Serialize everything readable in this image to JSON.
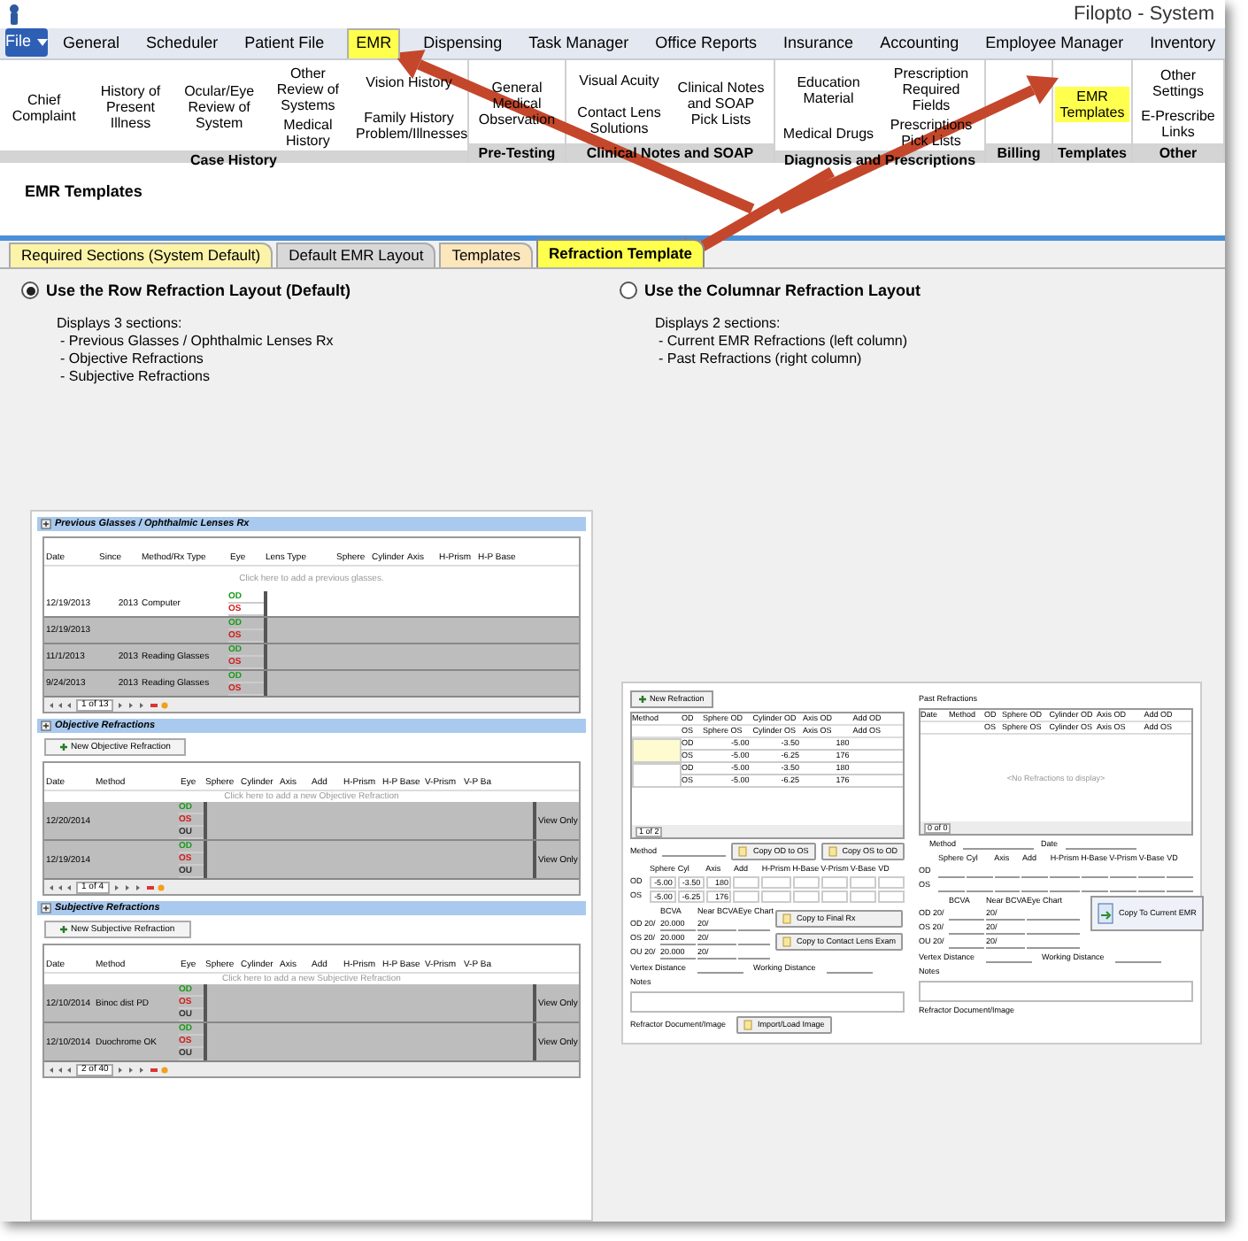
{
  "window": {
    "title": "Filopto - System"
  },
  "menu_tabs": [
    {
      "label": "File",
      "kind": "file",
      "selected": false
    },
    {
      "label": "General",
      "kind": "tab",
      "selected": false
    },
    {
      "label": "Scheduler",
      "kind": "tab",
      "selected": false
    },
    {
      "label": "Patient File",
      "kind": "tab",
      "selected": false
    },
    {
      "label": "EMR",
      "kind": "tab",
      "selected": true
    },
    {
      "label": "Dispensing",
      "kind": "tab",
      "selected": false
    },
    {
      "label": "Task Manager",
      "kind": "tab",
      "selected": false
    },
    {
      "label": "Office Reports",
      "kind": "tab",
      "selected": false
    },
    {
      "label": "Insurance",
      "kind": "tab",
      "selected": false
    },
    {
      "label": "Accounting",
      "kind": "tab",
      "selected": false
    },
    {
      "label": "Employee Manager",
      "kind": "tab",
      "selected": false
    },
    {
      "label": "Inventory",
      "kind": "tab",
      "selected": false
    }
  ],
  "ribbon_groups": [
    {
      "label": "Case History",
      "columns": [
        [
          {
            "label": "Chief Complaint",
            "selected": false
          }
        ],
        [
          {
            "label": "History of Present Illness",
            "selected": false
          }
        ],
        [
          {
            "label": "Ocular/Eye Review of System",
            "selected": false
          }
        ],
        [
          {
            "label": "Other Review of Systems",
            "selected": false
          },
          {
            "label": "Medical History",
            "selected": false
          }
        ],
        [
          {
            "label": "Vision History",
            "selected": false
          },
          {
            "label": "Family History Problem/Illnesses",
            "selected": false
          }
        ]
      ]
    },
    {
      "label": "Pre-Testing",
      "columns": [
        [
          {
            "label": "General Medical Observation",
            "selected": false
          }
        ]
      ]
    },
    {
      "label": "Clinical Notes and SOAP",
      "columns": [
        [
          {
            "label": "Visual Acuity",
            "selected": false
          },
          {
            "label": "Contact Lens Solutions",
            "selected": false
          }
        ],
        [
          {
            "label": "Clinical Notes and SOAP Pick Lists",
            "selected": false
          }
        ]
      ]
    },
    {
      "label": "Diagnosis and Prescriptions",
      "columns": [
        [
          {
            "label": "Education Material",
            "selected": false
          },
          {
            "label": "Medical Drugs",
            "selected": false
          }
        ],
        [
          {
            "label": "Prescription Required Fields",
            "selected": false
          },
          {
            "label": "Prescriptions Pick Lists",
            "selected": false
          }
        ]
      ]
    },
    {
      "label": "Billing"
    },
    {
      "label": "Templates",
      "columns": [
        [
          {
            "label": "EMR Templates",
            "selected": true
          }
        ]
      ]
    },
    {
      "label": "Other",
      "columns": [
        [
          {
            "label": "Other Settings",
            "selected": false
          },
          {
            "label": "E-Prescribe Links",
            "selected": false
          }
        ]
      ]
    }
  ],
  "page": {
    "title": "EMR Templates"
  },
  "tabs": [
    {
      "label": "Required Sections (System Default)",
      "color": "#fbf3a8",
      "selected": false
    },
    {
      "label": "Default EMR Layout",
      "color": "#d8d8d8",
      "selected": false
    },
    {
      "label": "Templates",
      "color": "#fce6bc",
      "selected": false
    },
    {
      "label": "Refraction Template",
      "color": "#ffff4d",
      "selected": true
    }
  ],
  "options": [
    {
      "label": "Use the Row Refraction Layout (Default)",
      "selected": true,
      "description": "Displays 3 sections:",
      "lines": [
        "- Previous Glasses / Ophthalmic Lenses Rx",
        "- Objective Refractions",
        "- Subjective Refractions"
      ]
    },
    {
      "label": "Use the Columnar Refraction Layout",
      "selected": false,
      "description": "Displays 2 sections:",
      "lines": [
        "- Current EMR Refractions (left column)",
        "- Past Refractions (right column)"
      ]
    }
  ],
  "row_preview": {
    "sections": [
      {
        "title": "Previous Glasses / Ophthalmic Lenses Rx",
        "headers": [
          "Date",
          "Since",
          "Method/Rx Type",
          "Eye",
          "Lens Type",
          "Sphere",
          "Cylinder",
          "Axis",
          "H-Prism",
          "H-P Base"
        ],
        "hint": "Click here to add a previous glasses.",
        "rows": [
          {
            "date": "12/19/2013",
            "since": "2013",
            "method": "Computer",
            "eyes": [
              "OD",
              "OS"
            ]
          },
          {
            "date": "12/19/2013",
            "eyes": [
              "OD",
              "OS"
            ]
          },
          {
            "date": "11/1/2013",
            "since": "2013",
            "method": "Reading Glasses",
            "eyes": [
              "OD",
              "OS"
            ]
          },
          {
            "date": "9/24/2013",
            "since": "2013",
            "method": "Reading Glasses",
            "eyes": [
              "OD",
              "OS"
            ]
          }
        ],
        "pager": "1 of 13"
      },
      {
        "title": "Objective Refractions",
        "button": "New Objective Refraction",
        "headers": [
          "Date",
          "Method",
          "Eye",
          "Sphere",
          "Cylinder",
          "Axis",
          "Add",
          "H-Prism",
          "H-P Base",
          "V-Prism",
          "V-P Ba"
        ],
        "hint": "Click here to add a new Objective Refraction",
        "rows": [
          {
            "date": "12/20/2014",
            "eyes": [
              "OD",
              "OS",
              "OU"
            ],
            "status": "View Only"
          },
          {
            "date": "12/19/2014",
            "eyes": [
              "OD",
              "OS",
              "OU"
            ],
            "status": "View Only"
          }
        ],
        "pager": "1 of 4"
      },
      {
        "title": "Subjective Refractions",
        "button": "New Subjective Refraction",
        "headers": [
          "Date",
          "Method",
          "Eye",
          "Sphere",
          "Cylinder",
          "Axis",
          "Add",
          "H-Prism",
          "H-P Base",
          "V-Prism",
          "V-P Ba"
        ],
        "hint": "Click here to add a new Subjective Refraction",
        "rows": [
          {
            "date": "12/10/2014",
            "method": "Binoc dist PD",
            "eyes": [
              "OD",
              "OS",
              "OU"
            ],
            "status": "View Only"
          },
          {
            "date": "12/10/2014",
            "method": "Duochrome OK",
            "eyes": [
              "OD",
              "OS",
              "OU"
            ],
            "status": "View Only"
          }
        ],
        "pager": "2 of 40"
      }
    ]
  },
  "columnar_preview": {
    "current": {
      "button": "New Refraction",
      "headers": [
        [
          "Method",
          "OD",
          "Sphere OD",
          "Cylinder OD",
          "Axis OD",
          "Add OD"
        ],
        [
          "OS",
          "Sphere OS",
          "Cylinder OS",
          "Axis OS",
          "Add OS"
        ]
      ],
      "entries": [
        {
          "selected": true,
          "rows": [
            [
              "OD",
              "-5.00",
              "-3.50",
              "180"
            ],
            [
              "OS",
              "-5.00",
              "-6.25",
              "176"
            ]
          ]
        },
        {
          "selected": false,
          "rows": [
            [
              "OD",
              "-5.00",
              "-3.50",
              "180"
            ],
            [
              "OS",
              "-5.00",
              "-6.25",
              "176"
            ]
          ]
        }
      ],
      "pager": "1 of 2",
      "method_label": "Method",
      "copy_buttons": [
        "Copy OD to OS",
        "Copy OS to OD"
      ],
      "rx_headers": [
        "Sphere",
        "Cyl",
        "Axis",
        "Add",
        "H-Prism",
        "H-Base",
        "V-Prism",
        "V-Base",
        "VD"
      ],
      "rx_rows": [
        {
          "eye": "OD",
          "values": [
            "-5.00",
            "-3.50",
            "180"
          ]
        },
        {
          "eye": "OS",
          "values": [
            "-5.00",
            "-6.25",
            "176"
          ]
        }
      ],
      "acuity_headers": [
        "BCVA",
        "Near BCVA",
        "Eye Chart"
      ],
      "acuity_rows": [
        {
          "eye": "OD 20/",
          "bcva": "20.000",
          "near": "20/"
        },
        {
          "eye": "OS 20/",
          "bcva": "20.000",
          "near": "20/"
        },
        {
          "eye": "OU 20/",
          "bcva": "20.000",
          "near": "20/"
        }
      ],
      "action_buttons": [
        "Copy to Final Rx",
        "Copy to Contact Lens Exam"
      ],
      "distances": [
        "Vertex Distance",
        "Working Distance"
      ],
      "notes_label": "Notes",
      "image_label": "Refractor Document/Image",
      "image_button": "Import/Load Image"
    },
    "past": {
      "title": "Past Refractions",
      "headers": [
        [
          "Date",
          "Method",
          "OD",
          "Sphere OD",
          "Cylinder OD",
          "Axis OD",
          "Add OD"
        ],
        [
          "OS",
          "Sphere OS",
          "Cylinder OS",
          "Axis OS",
          "Add OS"
        ]
      ],
      "empty": "<No Refractions to display>",
      "pager": "0 of 0",
      "labels": [
        "Method",
        "Date"
      ],
      "rx_headers": [
        "Sphere",
        "Cyl",
        "Axis",
        "Add",
        "H-Prism",
        "H-Base",
        "V-Prism",
        "V-Base",
        "VD"
      ],
      "rx_eyes": [
        "OD",
        "OS"
      ],
      "acuity_headers": [
        "BCVA",
        "Near BCVA",
        "Eye Chart"
      ],
      "acuity_rows": [
        {
          "eye": "OD 20/",
          "near": "20/"
        },
        {
          "eye": "OS 20/",
          "near": "20/"
        },
        {
          "eye": "OU 20/",
          "near": "20/"
        }
      ],
      "button": "Copy To Current EMR",
      "distances": [
        "Vertex Distance",
        "Working Distance"
      ],
      "notes_label": "Notes",
      "image_label": "Refractor Document/Image"
    }
  }
}
